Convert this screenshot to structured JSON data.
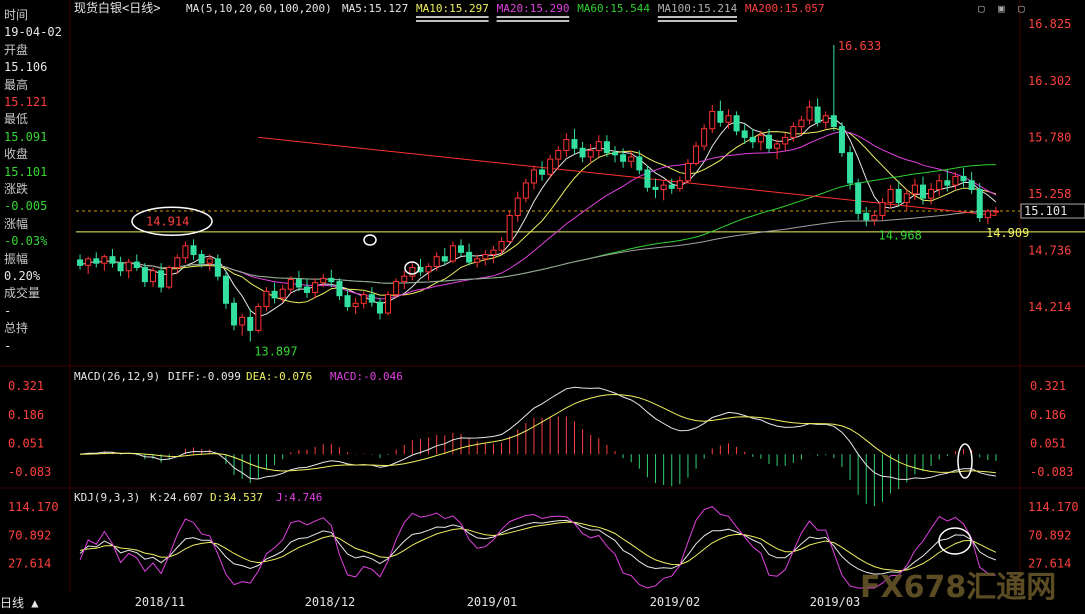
{
  "sidebar": {
    "labels": [
      "时间",
      "19-04-02",
      "开盘",
      "15.106",
      "最高",
      "15.121",
      "最低",
      "15.091",
      "收盘",
      "15.101",
      "涨跌",
      "-0.005",
      "涨幅",
      "-0.03%",
      "振幅",
      "0.20%",
      "成交量",
      "-",
      "总持",
      "-"
    ],
    "colors": [
      "lab",
      "w",
      "lab",
      "w",
      "lab",
      "r",
      "lab",
      "g",
      "lab",
      "g",
      "lab",
      "g",
      "lab",
      "g",
      "lab",
      "w",
      "lab",
      "w",
      "lab",
      "w"
    ]
  },
  "header": {
    "instrument": "现货白银",
    "period": "<日线>",
    "ma_label": "MA(5,10,20,60,100,200)",
    "ma_values": [
      {
        "label": "MA5:15.127",
        "color": "#e8e8e8"
      },
      {
        "label": "MA10:15.297",
        "color": "#f0f060"
      },
      {
        "label": "MA20:15.290",
        "color": "#e040e0"
      },
      {
        "label": "MA60:15.544",
        "color": "#30d030"
      },
      {
        "label": "MA100:15.214",
        "color": "#b0b0b0"
      },
      {
        "label": "MA200:15.057",
        "color": "#ff4040"
      }
    ]
  },
  "macd": {
    "label": "MACD(26,12,9)",
    "diff": "DIFF:-0.099",
    "dea": "DEA:-0.076",
    "macd": "MACD:-0.046"
  },
  "kdj": {
    "label": "KDJ(9,3,3)",
    "k": "K:24.607",
    "d": "D:34.537",
    "j": "J:4.746"
  },
  "price_axis": [
    "16.825",
    "16.302",
    "15.780",
    "15.258",
    "14.736",
    "14.214"
  ],
  "macd_axis": [
    "0.321",
    "0.186",
    "0.051",
    "-0.083"
  ],
  "kdj_axis": [
    "114.170",
    "70.892",
    "27.614"
  ],
  "x_axis": [
    "2018/11",
    "2018/12",
    "2019/01",
    "2019/02",
    "2019/03"
  ],
  "annotations": {
    "high": "16.633",
    "low": "13.897",
    "mid_low": "14.968",
    "left_marker": "14.914",
    "current_box": "15.101",
    "current_level": "14.909"
  },
  "bottom_tab": "日线 ▲",
  "watermark": "FX678汇通网",
  "colors": {
    "up": "#ff3333",
    "down": "#33e0a0",
    "bg": "#000000"
  },
  "chart_data": {
    "type": "candlestick",
    "title": "现货白银<日线>",
    "ylim": [
      13.69,
      16.9
    ],
    "gridlines": false,
    "ohlc": [
      [
        14.65,
        14.7,
        14.56,
        14.6
      ],
      [
        14.6,
        14.68,
        14.52,
        14.66
      ],
      [
        14.66,
        14.72,
        14.58,
        14.62
      ],
      [
        14.62,
        14.7,
        14.55,
        14.68
      ],
      [
        14.68,
        14.75,
        14.58,
        14.62
      ],
      [
        14.62,
        14.68,
        14.5,
        14.55
      ],
      [
        14.55,
        14.66,
        14.48,
        14.63
      ],
      [
        14.63,
        14.7,
        14.55,
        14.58
      ],
      [
        14.58,
        14.62,
        14.4,
        14.45
      ],
      [
        14.45,
        14.58,
        14.4,
        14.55
      ],
      [
        14.55,
        14.62,
        14.35,
        14.4
      ],
      [
        14.4,
        14.6,
        14.38,
        14.58
      ],
      [
        14.58,
        14.7,
        14.52,
        14.67
      ],
      [
        14.67,
        14.82,
        14.62,
        14.78
      ],
      [
        14.78,
        14.84,
        14.65,
        14.7
      ],
      [
        14.7,
        14.74,
        14.58,
        14.62
      ],
      [
        14.62,
        14.7,
        14.55,
        14.66
      ],
      [
        14.66,
        14.7,
        14.46,
        14.5
      ],
      [
        14.5,
        14.55,
        14.2,
        14.25
      ],
      [
        14.25,
        14.3,
        14.0,
        14.05
      ],
      [
        14.05,
        14.15,
        13.95,
        14.12
      ],
      [
        14.12,
        14.2,
        13.897,
        14.0
      ],
      [
        14.0,
        14.25,
        13.98,
        14.22
      ],
      [
        14.22,
        14.4,
        14.18,
        14.36
      ],
      [
        14.36,
        14.44,
        14.25,
        14.3
      ],
      [
        14.3,
        14.42,
        14.26,
        14.38
      ],
      [
        14.38,
        14.5,
        14.34,
        14.47
      ],
      [
        14.47,
        14.55,
        14.36,
        14.4
      ],
      [
        14.4,
        14.48,
        14.3,
        14.35
      ],
      [
        14.35,
        14.48,
        14.3,
        14.44
      ],
      [
        14.44,
        14.52,
        14.4,
        14.48
      ],
      [
        14.48,
        14.56,
        14.4,
        14.45
      ],
      [
        14.45,
        14.48,
        14.28,
        14.32
      ],
      [
        14.32,
        14.38,
        14.18,
        14.22
      ],
      [
        14.22,
        14.3,
        14.15,
        14.25
      ],
      [
        14.25,
        14.36,
        14.2,
        14.33
      ],
      [
        14.33,
        14.4,
        14.22,
        14.26
      ],
      [
        14.26,
        14.3,
        14.1,
        14.16
      ],
      [
        14.16,
        14.36,
        14.14,
        14.33
      ],
      [
        14.33,
        14.48,
        14.3,
        14.45
      ],
      [
        14.45,
        14.55,
        14.38,
        14.5
      ],
      [
        14.5,
        14.62,
        14.46,
        14.58
      ],
      [
        14.58,
        14.66,
        14.5,
        14.54
      ],
      [
        14.54,
        14.62,
        14.46,
        14.59
      ],
      [
        14.59,
        14.72,
        14.55,
        14.68
      ],
      [
        14.68,
        14.76,
        14.6,
        14.64
      ],
      [
        14.64,
        14.82,
        14.62,
        14.78
      ],
      [
        14.78,
        14.84,
        14.68,
        14.72
      ],
      [
        14.72,
        14.8,
        14.6,
        14.63
      ],
      [
        14.63,
        14.7,
        14.58,
        14.66
      ],
      [
        14.66,
        14.74,
        14.6,
        14.7
      ],
      [
        14.7,
        14.78,
        14.62,
        14.74
      ],
      [
        14.74,
        14.86,
        14.7,
        14.82
      ],
      [
        14.82,
        15.1,
        14.8,
        15.06
      ],
      [
        15.06,
        15.28,
        15.0,
        15.22
      ],
      [
        15.22,
        15.4,
        15.18,
        15.36
      ],
      [
        15.36,
        15.52,
        15.3,
        15.48
      ],
      [
        15.48,
        15.56,
        15.38,
        15.44
      ],
      [
        15.44,
        15.62,
        15.4,
        15.58
      ],
      [
        15.58,
        15.7,
        15.5,
        15.66
      ],
      [
        15.66,
        15.82,
        15.6,
        15.76
      ],
      [
        15.76,
        15.86,
        15.62,
        15.68
      ],
      [
        15.68,
        15.74,
        15.55,
        15.6
      ],
      [
        15.6,
        15.72,
        15.54,
        15.66
      ],
      [
        15.66,
        15.8,
        15.6,
        15.74
      ],
      [
        15.74,
        15.8,
        15.6,
        15.64
      ],
      [
        15.64,
        15.7,
        15.55,
        15.62
      ],
      [
        15.62,
        15.68,
        15.5,
        15.56
      ],
      [
        15.56,
        15.66,
        15.5,
        15.6
      ],
      [
        15.6,
        15.66,
        15.44,
        15.48
      ],
      [
        15.48,
        15.52,
        15.28,
        15.32
      ],
      [
        15.32,
        15.4,
        15.22,
        15.3
      ],
      [
        15.3,
        15.38,
        15.2,
        15.34
      ],
      [
        15.34,
        15.4,
        15.26,
        15.31
      ],
      [
        15.31,
        15.42,
        15.28,
        15.38
      ],
      [
        15.38,
        15.58,
        15.36,
        15.54
      ],
      [
        15.54,
        15.74,
        15.52,
        15.7
      ],
      [
        15.7,
        15.9,
        15.66,
        15.86
      ],
      [
        15.86,
        16.08,
        15.82,
        16.02
      ],
      [
        16.02,
        16.12,
        15.88,
        15.92
      ],
      [
        15.92,
        16.04,
        15.86,
        15.98
      ],
      [
        15.98,
        16.02,
        15.8,
        15.84
      ],
      [
        15.84,
        15.9,
        15.72,
        15.78
      ],
      [
        15.78,
        15.86,
        15.68,
        15.74
      ],
      [
        15.74,
        15.84,
        15.66,
        15.8
      ],
      [
        15.8,
        15.86,
        15.64,
        15.68
      ],
      [
        15.68,
        15.76,
        15.58,
        15.72
      ],
      [
        15.72,
        15.82,
        15.66,
        15.78
      ],
      [
        15.78,
        15.92,
        15.74,
        15.88
      ],
      [
        15.88,
        15.98,
        15.8,
        15.94
      ],
      [
        15.94,
        16.12,
        15.9,
        16.06
      ],
      [
        16.06,
        16.14,
        15.88,
        15.92
      ],
      [
        15.92,
        16.02,
        15.86,
        15.98
      ],
      [
        15.98,
        16.633,
        15.84,
        15.88
      ],
      [
        15.88,
        15.92,
        15.6,
        15.64
      ],
      [
        15.64,
        15.7,
        15.3,
        15.36
      ],
      [
        15.36,
        15.4,
        15.02,
        15.08
      ],
      [
        15.08,
        15.14,
        14.96,
        15.02
      ],
      [
        15.02,
        15.1,
        14.968,
        15.06
      ],
      [
        15.06,
        15.22,
        15.02,
        15.18
      ],
      [
        15.18,
        15.34,
        15.12,
        15.3
      ],
      [
        15.3,
        15.38,
        15.14,
        15.18
      ],
      [
        15.18,
        15.3,
        15.1,
        15.26
      ],
      [
        15.26,
        15.4,
        15.2,
        15.34
      ],
      [
        15.34,
        15.42,
        15.16,
        15.22
      ],
      [
        15.22,
        15.36,
        15.16,
        15.3
      ],
      [
        15.3,
        15.44,
        15.24,
        15.38
      ],
      [
        15.38,
        15.48,
        15.28,
        15.34
      ],
      [
        15.34,
        15.46,
        15.3,
        15.42
      ],
      [
        15.42,
        15.5,
        15.32,
        15.38
      ],
      [
        15.38,
        15.46,
        15.26,
        15.3
      ],
      [
        15.3,
        15.36,
        15.0,
        15.04
      ],
      [
        15.04,
        15.12,
        14.98,
        15.1
      ],
      [
        15.1,
        15.14,
        15.06,
        15.101
      ]
    ]
  }
}
